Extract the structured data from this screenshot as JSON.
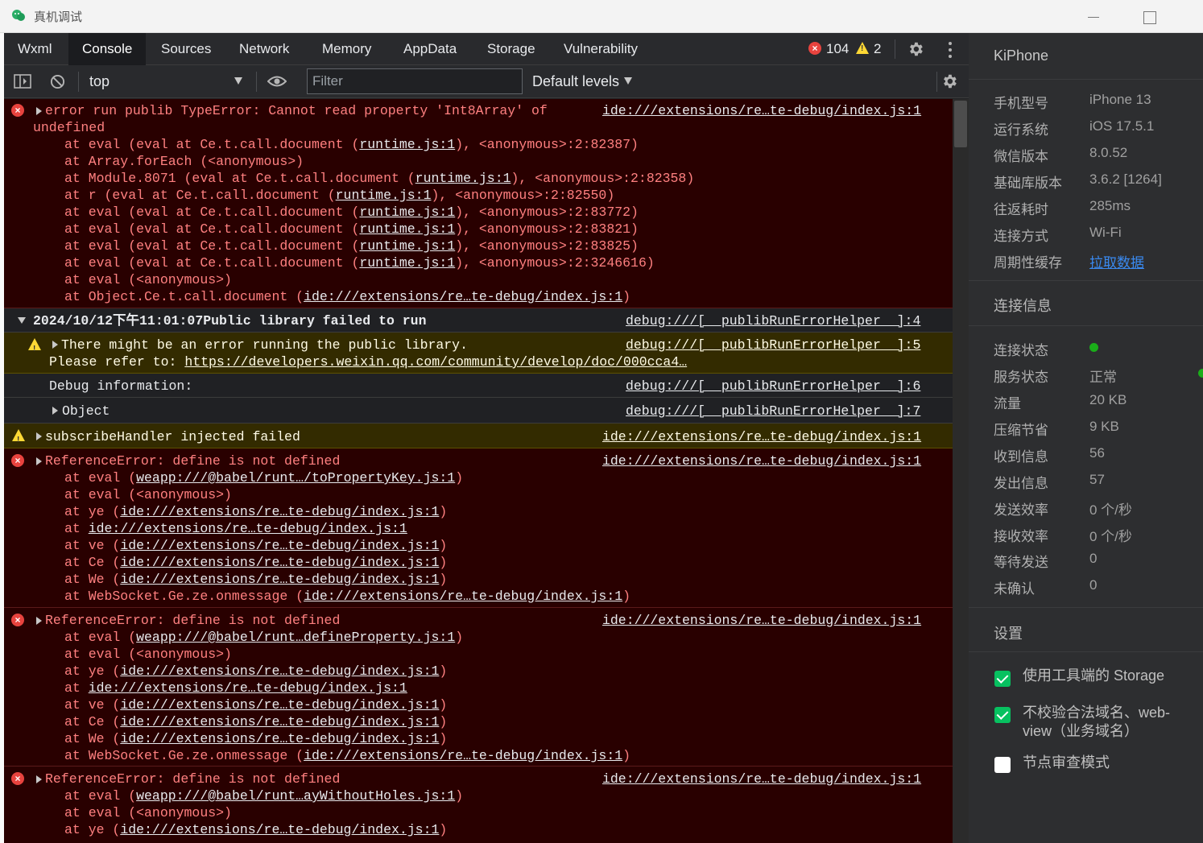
{
  "window": {
    "title": "真机调试"
  },
  "tabs": [
    {
      "label": "Wxml",
      "active": false
    },
    {
      "label": "Console",
      "active": true
    },
    {
      "label": "Sources",
      "active": false
    },
    {
      "label": "Network",
      "active": false
    },
    {
      "label": "Memory",
      "active": false
    },
    {
      "label": "AppData",
      "active": false
    },
    {
      "label": "Storage",
      "active": false
    },
    {
      "label": "Vulnerability",
      "active": false
    }
  ],
  "counts": {
    "errors": "104",
    "warnings": "2"
  },
  "toolbar": {
    "context": "top",
    "filter_placeholder": "Filter",
    "levels": "Default levels"
  },
  "messages": [
    {
      "source": "ide:///extensions/re…te-debug/index.js:1",
      "line1": "error run publib TypeError: Cannot read property 'Int8Array' of",
      "line2": "undefined",
      "stack": [
        [
          "at eval (eval at Ce.t.call.document (",
          "runtime.js:1",
          "), <anonymous>:2:82387)"
        ],
        [
          "at Array.forEach (<anonymous>)",
          "",
          ""
        ],
        [
          "at Module.8071 (eval at Ce.t.call.document (",
          "runtime.js:1",
          "), <anonymous>:2:82358)"
        ],
        [
          "at r (eval at Ce.t.call.document (",
          "runtime.js:1",
          "), <anonymous>:2:82550)"
        ],
        [
          "at eval (eval at Ce.t.call.document (",
          "runtime.js:1",
          "), <anonymous>:2:83772)"
        ],
        [
          "at eval (eval at Ce.t.call.document (",
          "runtime.js:1",
          "), <anonymous>:2:83821)"
        ],
        [
          "at eval (eval at Ce.t.call.document (",
          "runtime.js:1",
          "), <anonymous>:2:83825)"
        ],
        [
          "at eval (eval at Ce.t.call.document (",
          "runtime.js:1",
          "), <anonymous>:2:3246616)"
        ],
        [
          "at eval (<anonymous>)",
          "",
          ""
        ],
        [
          "at Object.Ce.t.call.document (",
          "ide:///extensions/re…te-debug/index.js:1",
          ")"
        ]
      ]
    },
    {
      "text": "2024/10/12下午11:01:07Public library failed to run",
      "source": "debug:///[__publibRunErrorHelper__]:4"
    },
    {
      "line1": "There might be an error running the public library.",
      "line2_prefix": "Please refer to: ",
      "line2_link": "https://developers.weixin.qq.com/community/develop/doc/000cca4…",
      "source": "debug:///[__publibRunErrorHelper__]:5"
    },
    {
      "text": "Debug information:",
      "source": "debug:///[__publibRunErrorHelper__]:6"
    },
    {
      "text": "Object",
      "source": "debug:///[__publibRunErrorHelper__]:7"
    },
    {
      "text": "subscribeHandler injected failed",
      "source": "ide:///extensions/re…te-debug/index.js:1"
    },
    {
      "text": "ReferenceError: define is not defined",
      "source": "ide:///extensions/re…te-debug/index.js:1",
      "stack": [
        [
          "at eval (",
          "weapp:///@babel/runt…/toPropertyKey.js:1",
          ")"
        ],
        [
          "at eval (<anonymous>)",
          "",
          ""
        ],
        [
          "at ye (",
          "ide:///extensions/re…te-debug/index.js:1",
          ")"
        ],
        [
          "at ",
          "ide:///extensions/re…te-debug/index.js:1",
          ""
        ],
        [
          "at ve (",
          "ide:///extensions/re…te-debug/index.js:1",
          ")"
        ],
        [
          "at Ce (",
          "ide:///extensions/re…te-debug/index.js:1",
          ")"
        ],
        [
          "at We (",
          "ide:///extensions/re…te-debug/index.js:1",
          ")"
        ],
        [
          "at WebSocket.Ge.ze.onmessage (",
          "ide:///extensions/re…te-debug/index.js:1",
          ")"
        ]
      ]
    },
    {
      "text": "ReferenceError: define is not defined",
      "source": "ide:///extensions/re…te-debug/index.js:1",
      "stack": [
        [
          "at eval (",
          "weapp:///@babel/runt…defineProperty.js:1",
          ")"
        ],
        [
          "at eval (<anonymous>)",
          "",
          ""
        ],
        [
          "at ye (",
          "ide:///extensions/re…te-debug/index.js:1",
          ")"
        ],
        [
          "at ",
          "ide:///extensions/re…te-debug/index.js:1",
          ""
        ],
        [
          "at ve (",
          "ide:///extensions/re…te-debug/index.js:1",
          ")"
        ],
        [
          "at Ce (",
          "ide:///extensions/re…te-debug/index.js:1",
          ")"
        ],
        [
          "at We (",
          "ide:///extensions/re…te-debug/index.js:1",
          ")"
        ],
        [
          "at WebSocket.Ge.ze.onmessage (",
          "ide:///extensions/re…te-debug/index.js:1",
          ")"
        ]
      ]
    },
    {
      "text": "ReferenceError: define is not defined",
      "source": "ide:///extensions/re…te-debug/index.js:1",
      "stack": [
        [
          "at eval (",
          "weapp:///@babel/runt…ayWithoutHoles.js:1",
          ")"
        ],
        [
          "at eval (<anonymous>)",
          "",
          ""
        ],
        [
          "at ye (",
          "ide:///extensions/re…te-debug/index.js:1",
          ")"
        ]
      ]
    }
  ],
  "panel": {
    "device": "KiPhone",
    "info": [
      {
        "k": "手机型号",
        "v": "iPhone 13"
      },
      {
        "k": "运行系统",
        "v": "iOS 17.5.1"
      },
      {
        "k": "微信版本",
        "v": "8.0.52"
      },
      {
        "k": "基础库版本",
        "v": "3.6.2 [1264]"
      },
      {
        "k": "往返耗时",
        "v": "285ms"
      },
      {
        "k": "连接方式",
        "v": "Wi-Fi"
      },
      {
        "k": "周期性缓存",
        "v": "拉取数据"
      }
    ],
    "conn_title": "连接信息",
    "conn": [
      {
        "k": "连接状态",
        "v": ""
      },
      {
        "k": "服务状态",
        "v": "正常"
      },
      {
        "k": "流量",
        "v": "20 KB"
      },
      {
        "k": "压缩节省",
        "v": "9 KB"
      },
      {
        "k": "收到信息",
        "v": "56"
      },
      {
        "k": "发出信息",
        "v": "57"
      },
      {
        "k": "发送效率",
        "v": "0 个/秒"
      },
      {
        "k": "接收效率",
        "v": "0 个/秒"
      },
      {
        "k": "等待发送",
        "v": "0"
      },
      {
        "k": "未确认",
        "v": "0"
      }
    ],
    "settings_title": "设置",
    "settings": [
      {
        "label": "使用工具端的 Storage",
        "checked": true
      },
      {
        "label": "不校验合法域名、web-view（业务域名）",
        "checked": true
      },
      {
        "label": "节点审查模式",
        "checked": false
      }
    ]
  },
  "colors": {
    "error_bg": "#290000",
    "error_text": "#ff8080",
    "warn_bg": "#332b00",
    "accent_green": "#07c160",
    "link_blue": "#3a8af0"
  }
}
